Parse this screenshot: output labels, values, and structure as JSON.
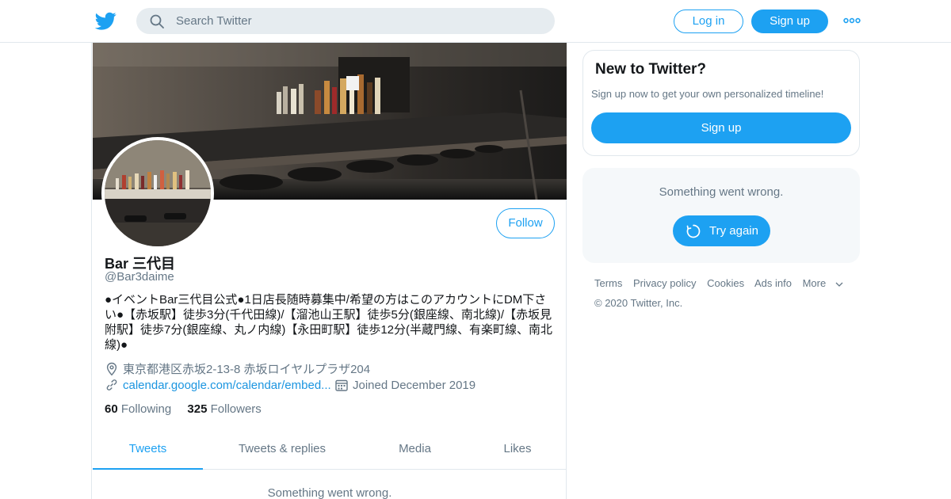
{
  "header": {
    "search_placeholder": "Search Twitter",
    "login_label": "Log in",
    "signup_label": "Sign up",
    "logo_icon": "twitter-bird-icon",
    "more_icon": "more-dots-icon"
  },
  "profile": {
    "display_name": "Bar 三代目",
    "handle": "@Bar3daime",
    "follow_label": "Follow",
    "bio": "●イベントBar三代目公式●1日店長随時募集中/希望の方はこのアカウントにDM下さい●【赤坂駅】徒歩3分(千代田線)/【溜池山王駅】徒歩5分(銀座線、南北線)/【赤坂見附駅】徒歩7分(銀座線、丸ノ内線)【永田町駅】徒歩12分(半蔵門線、有楽町線、南北線)●",
    "location": "東京都港区赤坂2-13-8 赤坂ロイヤルプラザ204",
    "url": "calendar.google.com/calendar/embed...",
    "joined": "Joined December 2019",
    "following_count": "60",
    "following_label": "Following",
    "followers_count": "325",
    "followers_label": "Followers"
  },
  "tabs": [
    {
      "label": "Tweets",
      "active": true
    },
    {
      "label": "Tweets & replies",
      "active": false
    },
    {
      "label": "Media",
      "active": false
    },
    {
      "label": "Likes",
      "active": false
    }
  ],
  "timeline": {
    "error": "Something went wrong."
  },
  "sidebar": {
    "new_title": "New to Twitter?",
    "new_sub": "Sign up now to get your own personalized timeline!",
    "new_signup_label": "Sign up",
    "error_msg": "Something went wrong.",
    "retry_label": "Try again"
  },
  "footer": {
    "links": [
      "Terms",
      "Privacy policy",
      "Cookies",
      "Ads info",
      "More"
    ],
    "copyright": "© 2020 Twitter, Inc."
  },
  "colors": {
    "accent": "#1da1f2",
    "text_primary": "#14171a",
    "text_secondary": "#657786",
    "border": "#e1e8ed",
    "search_bg": "#e6ecf0",
    "panel_bg": "#f5f8fa"
  }
}
